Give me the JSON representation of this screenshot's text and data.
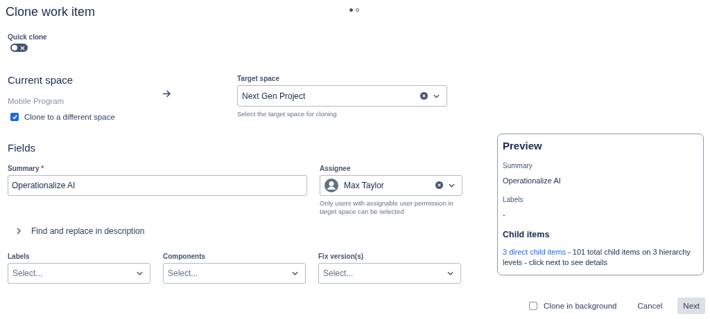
{
  "title": "Clone work item",
  "pager": [
    {
      "selected": true
    },
    {
      "selected": false
    }
  ],
  "quick_clone": {
    "label": "Quick clone",
    "on": false
  },
  "current_space": {
    "heading": "Current space",
    "name": "Mobile Program",
    "clone_different": {
      "label": "Clone to a different space",
      "checked": true
    }
  },
  "target_space": {
    "label": "Target space",
    "value": "Next Gen Project",
    "helper": "Select the target space for cloning"
  },
  "fields": {
    "heading": "Fields",
    "summary": {
      "label": "Summary",
      "required_mark": "*",
      "value": "Operationalize AI"
    },
    "assignee": {
      "label": "Assignee",
      "value": "Max Taylor",
      "helper": "Only users with assignable user permission in target space can be selected"
    },
    "find_replace": {
      "label": "Find and replace in description",
      "expanded": false
    },
    "selects": [
      {
        "label": "Labels",
        "placeholder": "Select..."
      },
      {
        "label": "Components",
        "placeholder": "Select..."
      },
      {
        "label": "Fix version(s)",
        "placeholder": "Select..."
      }
    ]
  },
  "preview": {
    "heading": "Preview",
    "summary_label": "Summary",
    "summary_value": "Operationalize AI",
    "labels_label": "Labels",
    "labels_value": "-",
    "child_heading": "Child items",
    "child_link": "3 direct child items",
    "child_text": " - 101 total child items on 3 hierarchy levels - click next to see details"
  },
  "footer": {
    "background": {
      "label": "Clone in background",
      "checked": false
    },
    "cancel": "Cancel",
    "next": "Next"
  }
}
